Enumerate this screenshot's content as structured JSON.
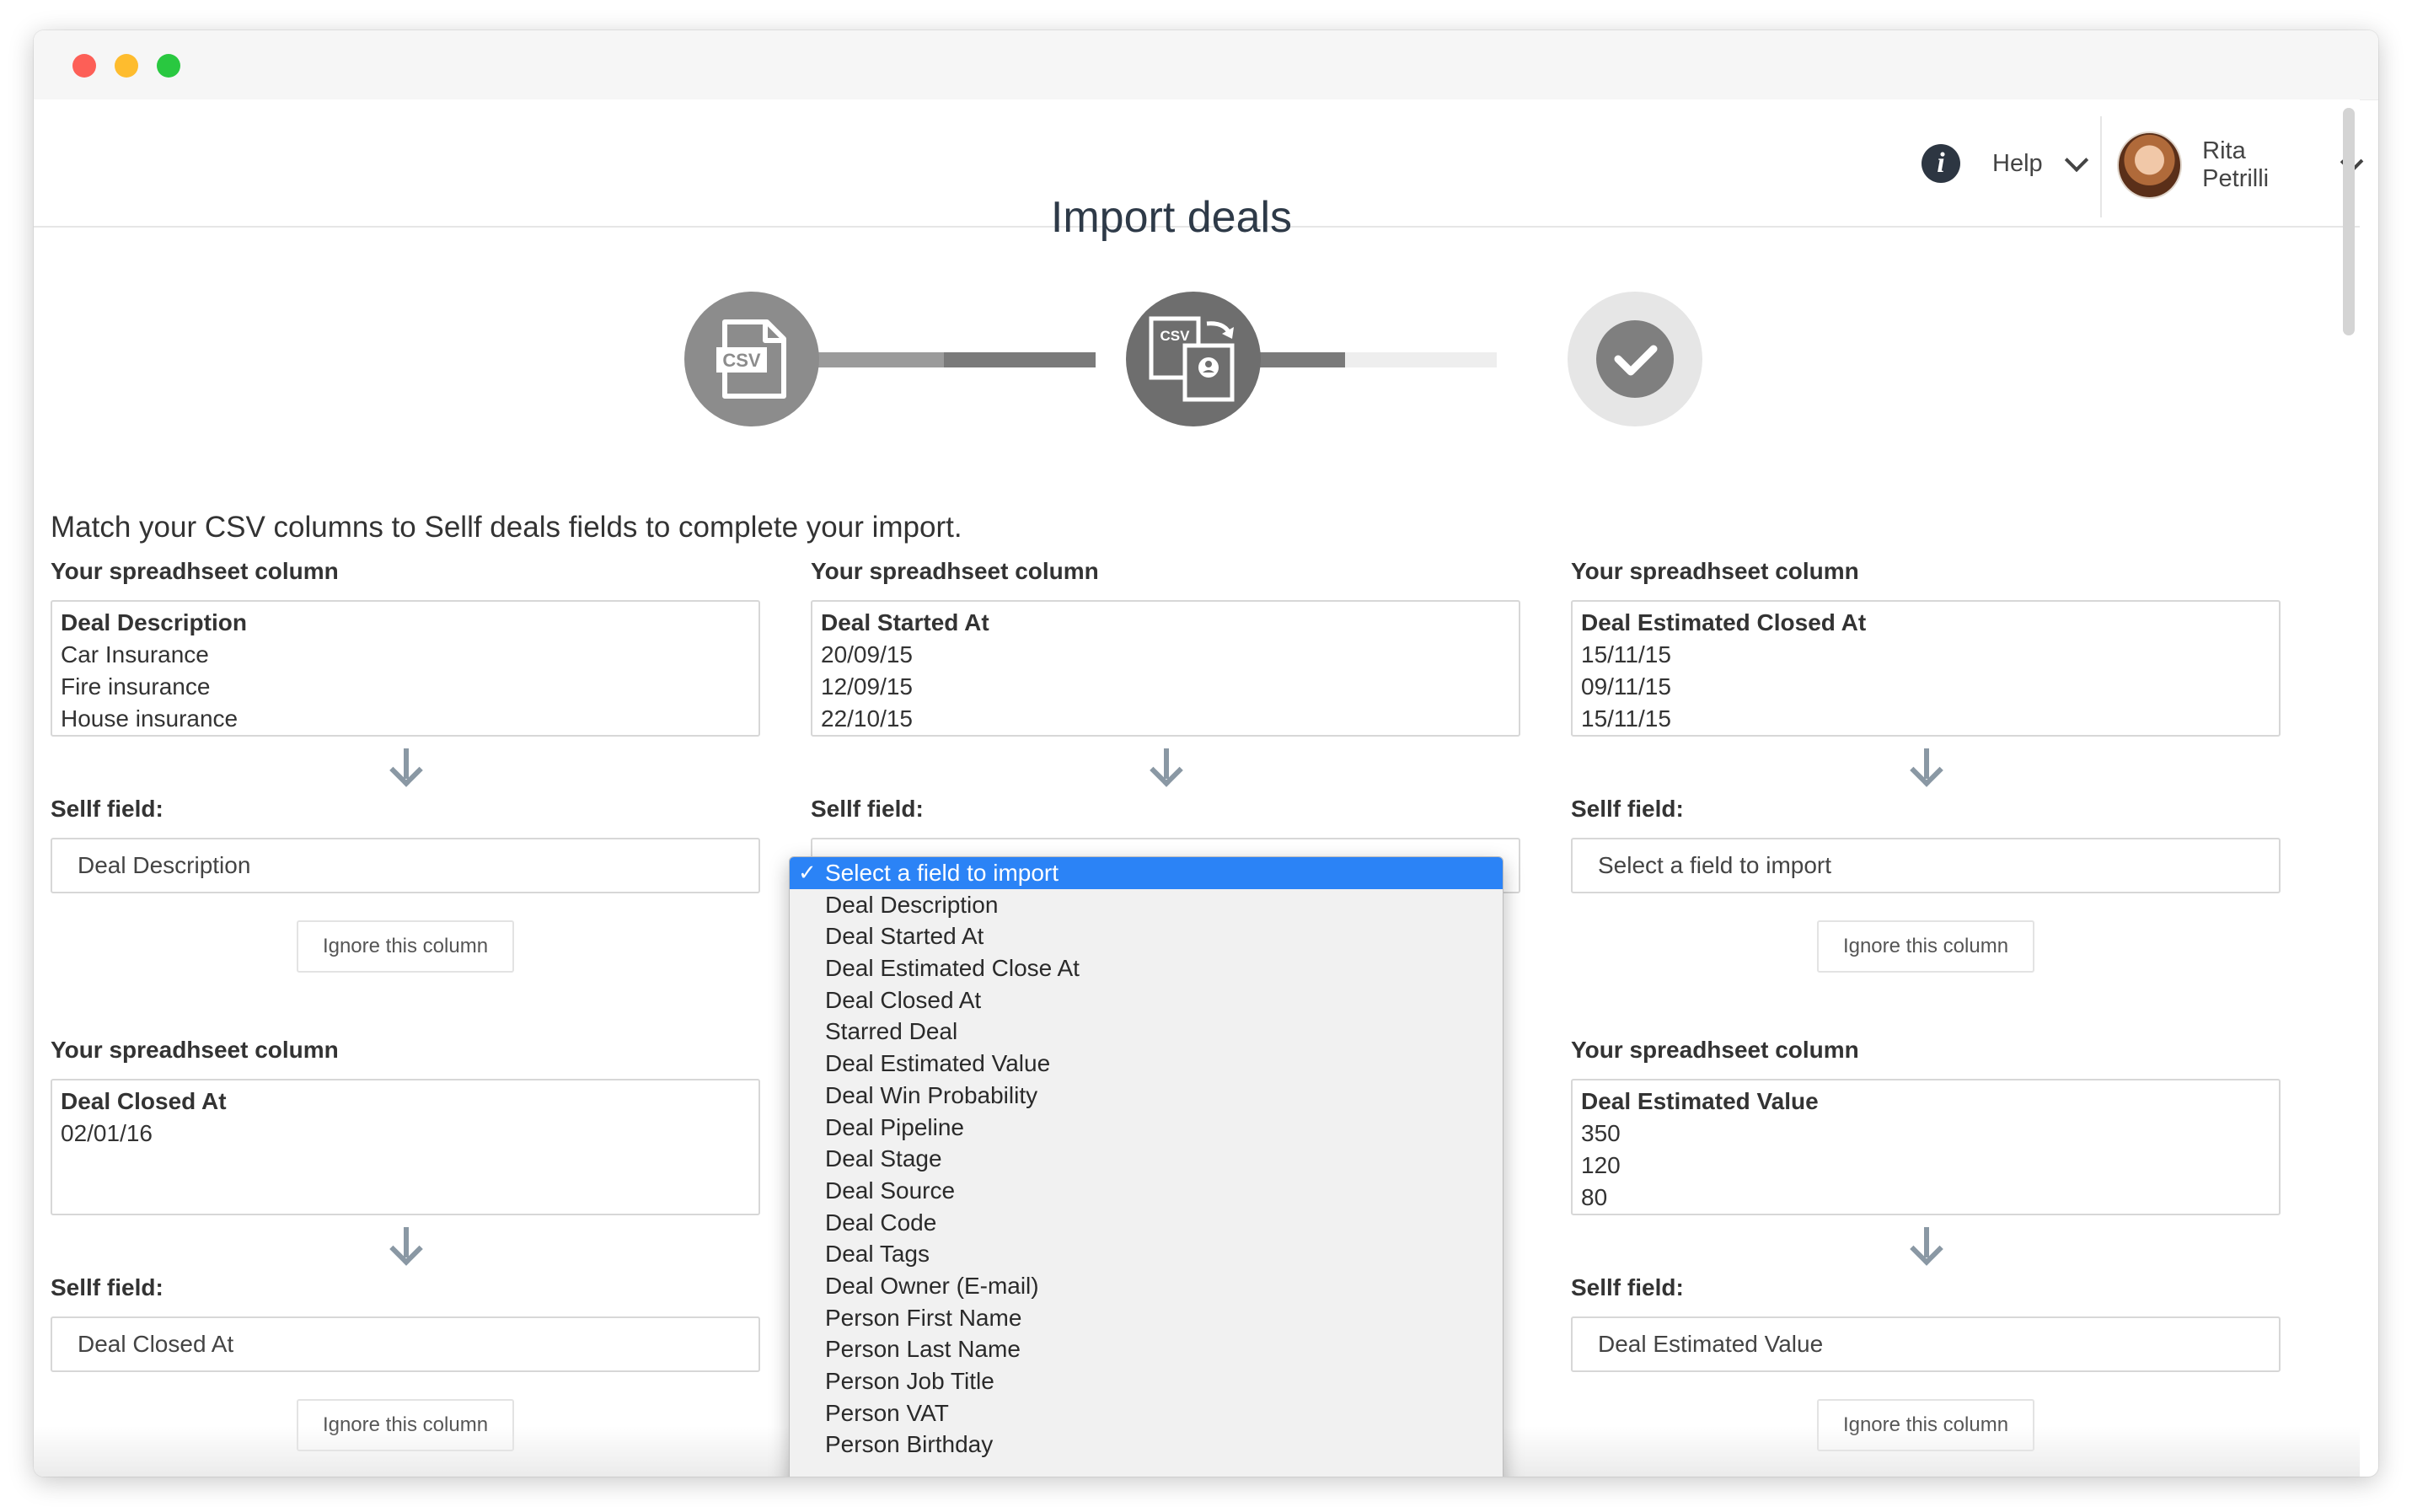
{
  "header": {
    "help_label": "Help",
    "user_name": "Rita Petrilli"
  },
  "page": {
    "title": "Import deals",
    "subtitle": "Match your CSV columns to Sellf deals fields to complete your import."
  },
  "stepper": {
    "step1_badge": "CSV",
    "step2_badge": "CSV"
  },
  "labels": {
    "spreadsheet_column": "Your spreadhseet column",
    "sellf_field": "Sellf field:",
    "ignore": "Ignore this column"
  },
  "cards": [
    {
      "header": "Deal Description",
      "rows": [
        "Car Insurance",
        "Fire insurance",
        "House insurance"
      ],
      "field": "Deal Description"
    },
    {
      "header": "Deal Started At",
      "rows": [
        "20/09/15",
        "12/09/15",
        "22/10/15"
      ],
      "field": "Select a field to import"
    },
    {
      "header": "Deal Estimated Closed At",
      "rows": [
        "15/11/15",
        "09/11/15",
        "15/11/15"
      ],
      "field": "Select a field to import"
    },
    {
      "header": "Deal Closed At",
      "rows": [
        "",
        "02/01/16",
        ""
      ],
      "field": "Deal Closed At"
    },
    {
      "header": "",
      "rows": [
        "",
        "",
        ""
      ],
      "field": ""
    },
    {
      "header": "Deal Estimated Value",
      "rows": [
        "350",
        "120",
        "80"
      ],
      "field": "Deal Estimated Value"
    }
  ],
  "dropdown": {
    "items": [
      "Select a field to import",
      "Deal Description",
      "Deal Started At",
      "Deal Estimated Close At",
      "Deal Closed At",
      "Starred Deal",
      "Deal Estimated Value",
      "Deal Win Probability",
      "Deal Pipeline",
      "Deal Stage",
      "Deal Source",
      "Deal Code",
      "Deal Tags",
      "Deal Owner (E-mail)",
      "Person First Name",
      "Person Last Name",
      "Person Job Title",
      "Person VAT",
      "Person Birthday"
    ],
    "selected_index": 0,
    "check_mark": "✓"
  },
  "colors": {
    "accent": "#2b83f6",
    "arrow": "#8a98a4",
    "title": "#2e3a48"
  }
}
